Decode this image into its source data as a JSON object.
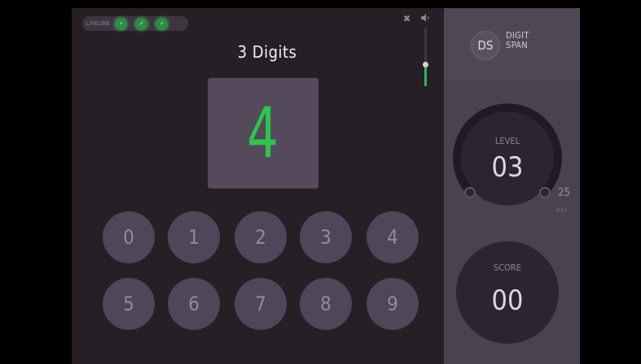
{
  "game": {
    "lifeline_label": "LIFELINE",
    "lifelines": [
      "✔",
      "✔",
      "✔"
    ],
    "title": "3 Digits",
    "current_digit": "4",
    "keypad": [
      "0",
      "1",
      "2",
      "3",
      "4",
      "5",
      "6",
      "7",
      "8",
      "9"
    ],
    "volume_level": 0.38,
    "accent_color": "#2ec44e"
  },
  "panel": {
    "logo_initials": "DS",
    "logo_line1": "DIGIT",
    "logo_line2": "SPAN",
    "level_label": "LEVEL",
    "level_value": "03",
    "level_max": "25",
    "level_max_label": "MAX",
    "score_label": "SCORE",
    "score_value": "00"
  },
  "icons": {
    "close": "close-icon",
    "volume": "speaker-icon",
    "lifeline": "check-icon"
  }
}
